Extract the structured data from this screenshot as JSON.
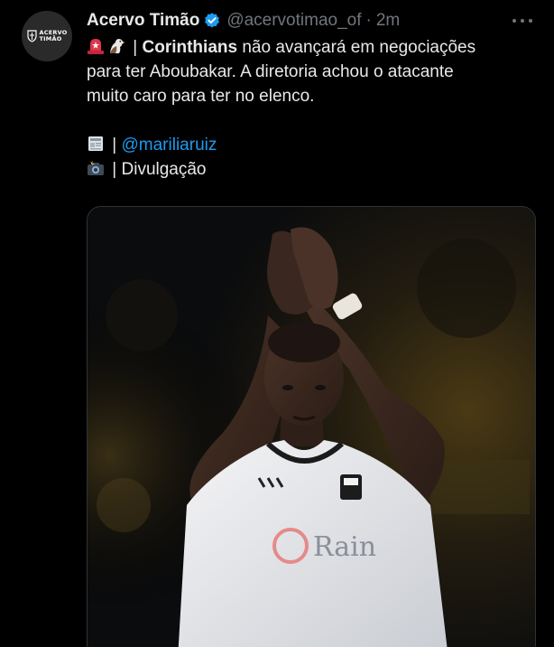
{
  "author": {
    "display_name": "Acervo Timão",
    "handle": "@acervotimao_of",
    "separator": "·",
    "time": "2m",
    "avatar_text": "ACERVO\nTIMÃO",
    "verified_color": "#1d9bf0"
  },
  "tweet": {
    "line1_prefix": " | ",
    "line1_bold": "Corinthians",
    "line1_rest": " não avançará em negociações",
    "line2": "para ter Aboubakar. A diretoria achou o atacante",
    "line3": "muito caro para ter no elenco.",
    "source_separator": " | ",
    "source_mention": "@mariliaruiz",
    "photo_separator": " | ",
    "photo_credit": "Divulgação"
  },
  "icons": {
    "siren": "siren-icon",
    "eagle": "eagle-icon",
    "newspaper": "newspaper-icon",
    "camera_flash": "camera-flash-icon",
    "verified": "verified-badge-icon",
    "more": "more-options-icon"
  },
  "media": {
    "jersey_text": "Rain",
    "colors": {
      "mention": "#1d9bf0",
      "muted": "#71767b",
      "text": "#e7e9ea"
    }
  }
}
